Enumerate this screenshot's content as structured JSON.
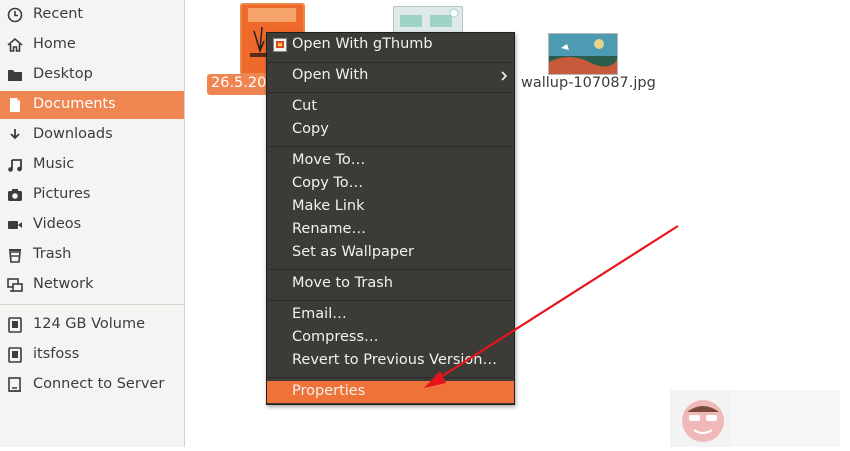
{
  "sidebar": {
    "items": [
      {
        "label": "Recent",
        "icon": "clock-icon"
      },
      {
        "label": "Home",
        "icon": "home-icon"
      },
      {
        "label": "Desktop",
        "icon": "folder-icon"
      },
      {
        "label": "Documents",
        "icon": "document-icon",
        "active": true
      },
      {
        "label": "Downloads",
        "icon": "download-icon"
      },
      {
        "label": "Music",
        "icon": "music-icon"
      },
      {
        "label": "Pictures",
        "icon": "camera-icon"
      },
      {
        "label": "Videos",
        "icon": "video-icon"
      },
      {
        "label": "Trash",
        "icon": "trash-icon"
      },
      {
        "label": "Network",
        "icon": "network-icon"
      }
    ],
    "devices": [
      {
        "label": "124 GB Volume",
        "icon": "drive-icon"
      },
      {
        "label": "itsfoss",
        "icon": "drive-icon"
      },
      {
        "label": "Connect to Server",
        "icon": "server-icon"
      }
    ]
  },
  "files": [
    {
      "name": "26.5.201",
      "selected": true
    },
    {
      "name": "",
      "selected": false
    },
    {
      "name": "wallup-107087.jpg",
      "selected": false
    }
  ],
  "context_menu": {
    "items": [
      "Open With gThumb",
      "Open With",
      "Cut",
      "Copy",
      "Move To…",
      "Copy To…",
      "Make Link",
      "Rename…",
      "Set as Wallpaper",
      "Move to Trash",
      "Email…",
      "Compress…",
      "Revert to Previous Version…",
      "Properties"
    ],
    "highlighted": "Properties"
  },
  "colors": {
    "accent": "#ef8551",
    "menu_bg": "#3c3b37",
    "highlight": "#ef7238",
    "arrow": "#e8141b"
  }
}
